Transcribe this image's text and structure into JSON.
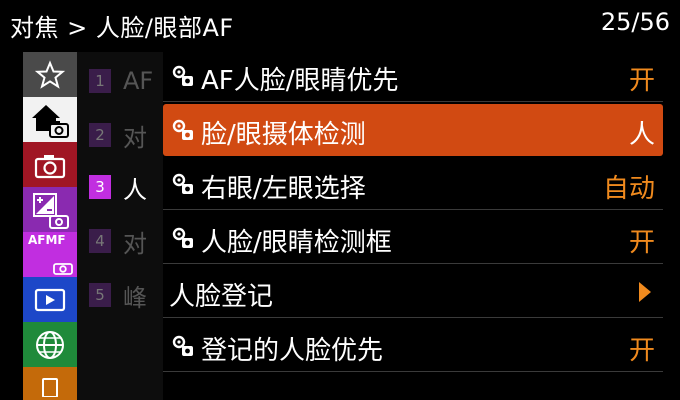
{
  "header": {
    "breadcrumb": "对焦 > 人脸/眼部AF",
    "page_indicator": "25/56"
  },
  "tabs": [
    {
      "icon": "star-icon",
      "color": "#4a4a4a"
    },
    {
      "icon": "home-camera-icon",
      "color": "#f2f2f2",
      "active": true
    },
    {
      "icon": "camera-icon",
      "color": "#a01624"
    },
    {
      "icon": "exposure-icon",
      "color": "#8a2ab0"
    },
    {
      "icon": "afmf-icon",
      "label": "AFMF",
      "color": "#c12ee0"
    },
    {
      "icon": "play-icon",
      "color": "#1d47c8"
    },
    {
      "icon": "globe-icon",
      "color": "#1f8a3a"
    },
    {
      "icon": "card-icon",
      "color": "#c46a0a"
    }
  ],
  "sublist": [
    {
      "number": "1",
      "label": "AF"
    },
    {
      "number": "2",
      "label": "对"
    },
    {
      "number": "3",
      "label": "人",
      "active": true
    },
    {
      "number": "4",
      "label": "对"
    },
    {
      "number": "5",
      "label": "峰"
    }
  ],
  "menu": [
    {
      "label": "AF人脸/眼睛优先",
      "value": "开",
      "icon": "setting-icon"
    },
    {
      "label": "脸/眼摄体检测",
      "value": "人",
      "icon": "setting-icon",
      "selected": true
    },
    {
      "label": "右眼/左眼选择",
      "value": "自动",
      "icon": "setting-icon"
    },
    {
      "label": "人脸/眼睛检测框",
      "value": "开",
      "icon": "setting-icon"
    },
    {
      "label": "人脸登记",
      "value": "",
      "icon": "",
      "arrow": true
    },
    {
      "label": "登记的人脸优先",
      "value": "开",
      "icon": "setting-icon"
    }
  ],
  "colors": {
    "accent": "#d14a12",
    "value": "#f08a1e",
    "active_sub": "#c12ee0"
  }
}
